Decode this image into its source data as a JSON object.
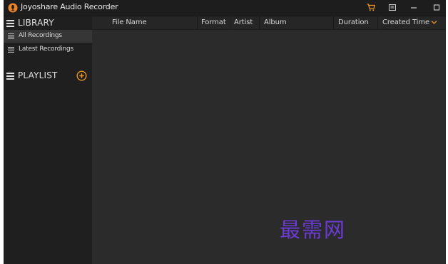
{
  "app": {
    "title": "Joyoshare Audio Recorder",
    "icon": "app-logo-icon"
  },
  "titlebar": {
    "buttons": [
      {
        "name": "cart-icon",
        "color": "#e8962a"
      },
      {
        "name": "menu-icon"
      },
      {
        "name": "minimize-icon"
      },
      {
        "name": "maximize-icon"
      }
    ]
  },
  "sidebar": {
    "library": {
      "label": "LIBRARY",
      "items": [
        {
          "label": "All Recordings",
          "active": true
        },
        {
          "label": "Latest Recordings",
          "active": false
        }
      ]
    },
    "playlist": {
      "label": "PLAYLIST",
      "add_icon": "add-circle-icon"
    }
  },
  "table": {
    "columns": [
      {
        "label": "File Name"
      },
      {
        "label": "Format"
      },
      {
        "label": "Artist"
      },
      {
        "label": "Album"
      },
      {
        "label": "Duration"
      },
      {
        "label": "Created Time"
      }
    ],
    "sort_indicator": "chevron-down-icon",
    "rows": []
  },
  "watermark": {
    "text": "最需网",
    "color": "#6c3bd6"
  },
  "colors": {
    "accent": "#e8962a",
    "background": "#2b2b2b",
    "sidebar": "#1f1f1f"
  }
}
